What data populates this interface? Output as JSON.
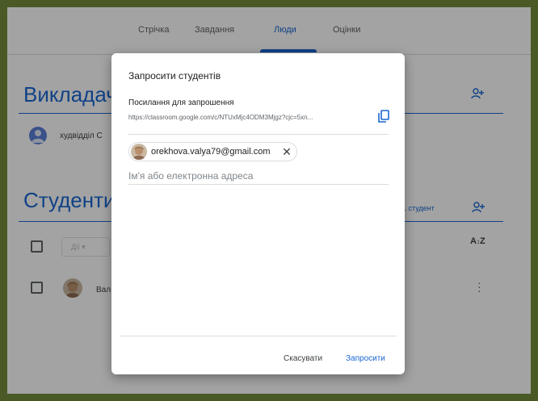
{
  "colors": {
    "accent": "#1967d2",
    "frame_border": "#4a5a26",
    "text_secondary": "#5f6368"
  },
  "tabs": [
    {
      "label": "Стрічка",
      "active": false
    },
    {
      "label": "Завдання",
      "active": false
    },
    {
      "label": "Люди",
      "active": true
    },
    {
      "label": "Оцінки",
      "active": false
    }
  ],
  "teachers": {
    "title": "Викладачі",
    "add_icon": "person-add-icon",
    "items": [
      {
        "name": "худвідділ С"
      }
    ]
  },
  "students": {
    "title": "Студенти",
    "count_label": "1 студент",
    "add_icon": "person-add-icon",
    "actions_label": "Дії",
    "sort_icon": "sort-az-icon",
    "items": [
      {
        "name": "Вал"
      }
    ]
  },
  "dialog": {
    "title": "Запросити студентів",
    "invite_link_label": "Посилання для запрошення",
    "invite_link_url": "https://classroom.google.com/c/NTUxMjc4ODM3Mjgz?cjc=5xn...",
    "copy_icon": "copy-icon",
    "chip": {
      "email": "orekhova.valya79@gmail.com",
      "remove_icon": "close-icon"
    },
    "input_placeholder": "Ім'я або електронна адреса",
    "cancel_label": "Скасувати",
    "invite_label": "Запросити"
  }
}
